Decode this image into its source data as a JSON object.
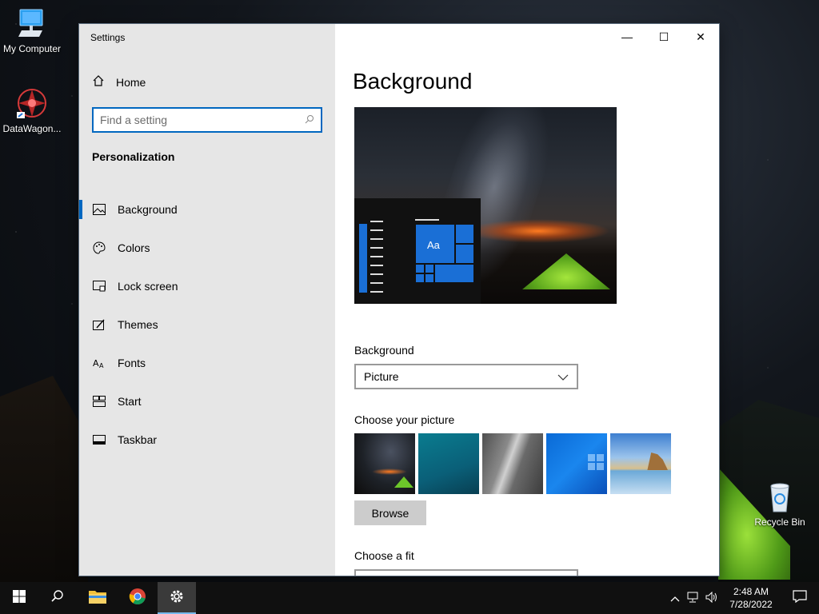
{
  "desktop": {
    "icons": [
      {
        "label": "My Computer"
      },
      {
        "label": "DataWagon..."
      },
      {
        "label": "Recycle Bin"
      }
    ]
  },
  "window": {
    "title": "Settings",
    "controls": {
      "minimize": "—",
      "maximize": "☐",
      "close": "✕"
    }
  },
  "sidebar": {
    "home_label": "Home",
    "search_placeholder": "Find a setting",
    "section_title": "Personalization",
    "items": [
      {
        "label": "Background",
        "icon": "picture-icon",
        "active": true
      },
      {
        "label": "Colors",
        "icon": "palette-icon"
      },
      {
        "label": "Lock screen",
        "icon": "lock-screen-icon"
      },
      {
        "label": "Themes",
        "icon": "themes-icon"
      },
      {
        "label": "Fonts",
        "icon": "fonts-icon"
      },
      {
        "label": "Start",
        "icon": "start-icon"
      },
      {
        "label": "Taskbar",
        "icon": "taskbar-icon"
      }
    ]
  },
  "main": {
    "title": "Background",
    "preview_tile_text": "Aa",
    "background_label": "Background",
    "background_value": "Picture",
    "choose_picture_label": "Choose your picture",
    "browse_label": "Browse",
    "choose_fit_label": "Choose a fit"
  },
  "taskbar": {
    "time": "2:48 AM",
    "date": "7/28/2022",
    "accent": "#76b9ed"
  },
  "colors": {
    "accent": "#0067c0",
    "sidebar_bg": "#e6e6e6"
  }
}
